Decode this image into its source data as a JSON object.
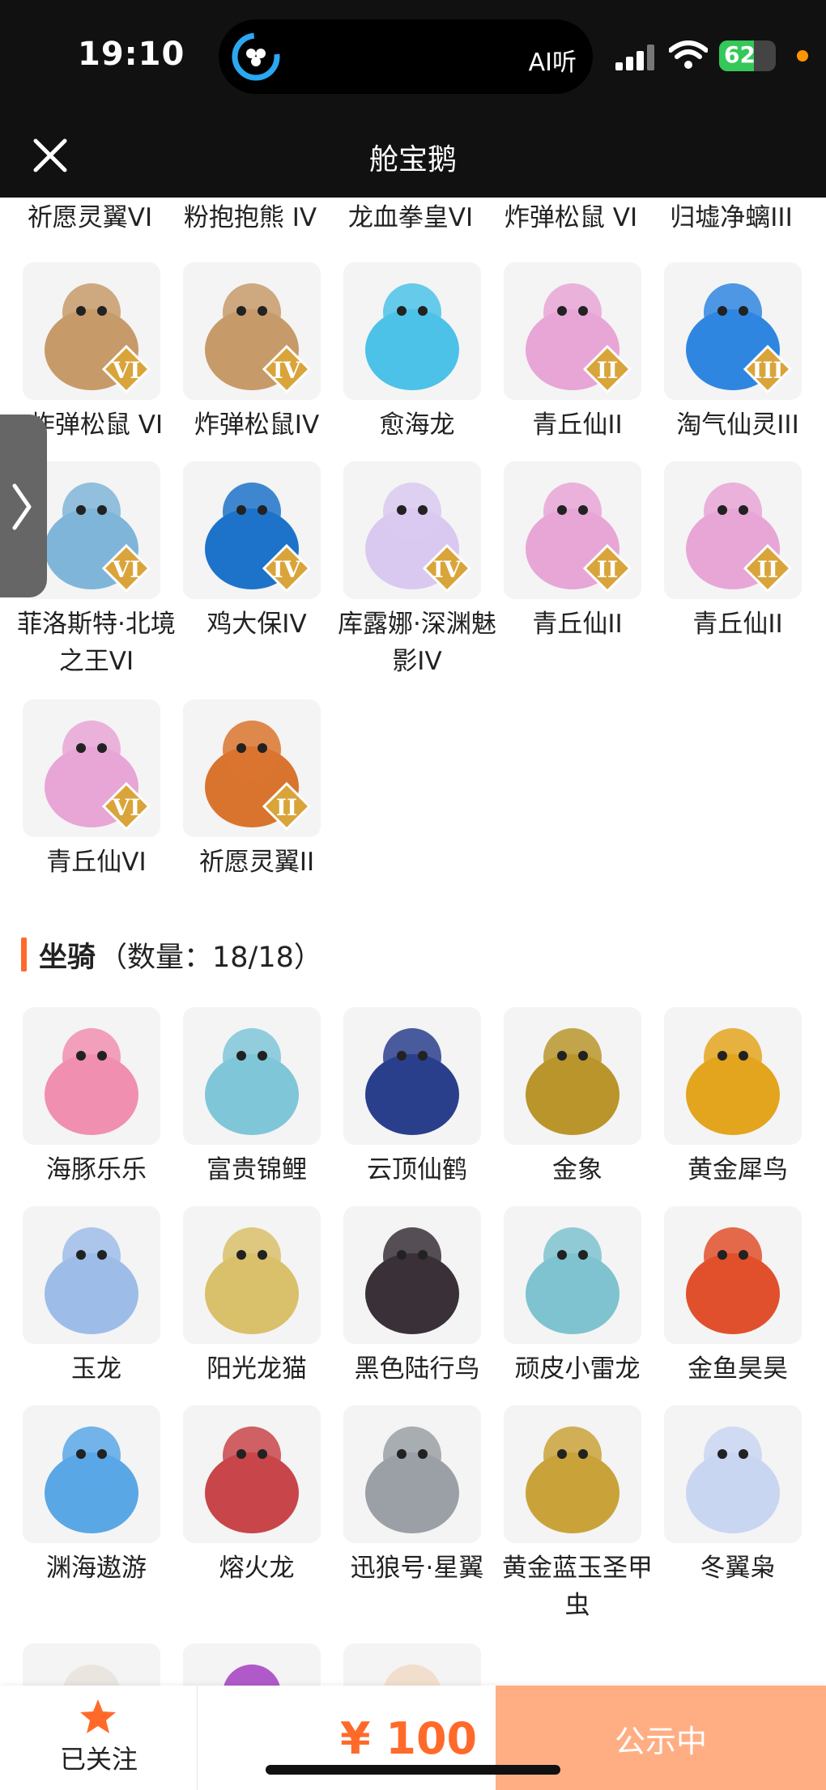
{
  "status_bar": {
    "time": "19:10",
    "island_text": "AI听",
    "battery": "62",
    "battery_fraction": 0.62
  },
  "nav": {
    "title": "舱宝鹅"
  },
  "top_partial_labels": [
    "祈愿灵翼VI",
    "粉抱抱熊 IV",
    "龙血拳皇VI",
    "炸弹松鼠 VI",
    "归墟净螭III"
  ],
  "pets": [
    {
      "label": "炸弹松鼠 VI",
      "icon": "squirrel-icon",
      "badge": "VI",
      "color": "#c79a6a"
    },
    {
      "label": "炸弹松鼠IV",
      "icon": "squirrel-icon",
      "badge": "IV",
      "color": "#c79a6a"
    },
    {
      "label": "愈海龙",
      "icon": "sea-dragon-icon",
      "badge": "",
      "color": "#4cc2e8"
    },
    {
      "label": "青丘仙II",
      "icon": "fox-fairy-icon",
      "badge": "II",
      "color": "#e7a6d6"
    },
    {
      "label": "淘气仙灵III",
      "icon": "blue-pup-icon",
      "badge": "III",
      "color": "#2f86e0"
    },
    {
      "label": "菲洛斯特·北境之王VI",
      "icon": "ice-king-icon",
      "badge": "VI",
      "color": "#7fb5d8"
    },
    {
      "label": "鸡大保IV",
      "icon": "bird-icon",
      "badge": "IV",
      "color": "#1d73c9"
    },
    {
      "label": "库露娜·深渊魅影IV",
      "icon": "phantom-icon",
      "badge": "IV",
      "color": "#d9c9f0"
    },
    {
      "label": "青丘仙II",
      "icon": "fox-fairy-icon",
      "badge": "II",
      "color": "#e7a6d6"
    },
    {
      "label": "青丘仙II",
      "icon": "fox-fairy-icon",
      "badge": "II",
      "color": "#e7a6d6"
    },
    {
      "label": "青丘仙VI",
      "icon": "fox-fairy-icon",
      "badge": "VI",
      "color": "#e7a6d6"
    },
    {
      "label": "祈愿灵翼II",
      "icon": "eagle-icon",
      "badge": "II",
      "color": "#d9742e"
    }
  ],
  "mounts_section": {
    "title": "坐骑",
    "count": "（数量：18/18）"
  },
  "mounts": [
    {
      "label": "海豚乐乐",
      "icon": "dolphin-icon",
      "color": "#f08fb0"
    },
    {
      "label": "富贵锦鲤",
      "icon": "koi-icon",
      "color": "#7fc6d8"
    },
    {
      "label": "云顶仙鹤",
      "icon": "crane-icon",
      "color": "#2a3f8c"
    },
    {
      "label": "金象",
      "icon": "elephant-icon",
      "color": "#b9952b"
    },
    {
      "label": "黄金犀鸟",
      "icon": "hornbill-icon",
      "color": "#e3a51e"
    },
    {
      "label": "玉龙",
      "icon": "jade-dragon-icon",
      "color": "#9dbde8"
    },
    {
      "label": "阳光龙猫",
      "icon": "cat-icon",
      "color": "#d9c06a"
    },
    {
      "label": "黑色陆行鸟",
      "icon": "black-bird-icon",
      "color": "#3a3038"
    },
    {
      "label": "顽皮小雷龙",
      "icon": "brontosaurus-icon",
      "color": "#7ec3cf"
    },
    {
      "label": "金鱼昊昊",
      "icon": "goldfish-icon",
      "color": "#e0502c"
    },
    {
      "label": "渊海遨游",
      "icon": "sea-prince-icon",
      "color": "#5aa7e6"
    },
    {
      "label": "熔火龙",
      "icon": "lava-dragon-icon",
      "color": "#c8454a"
    },
    {
      "label": "迅狼号·星翼",
      "icon": "mech-wolf-icon",
      "color": "#9aa0a6"
    },
    {
      "label": "黄金蓝玉圣甲虫",
      "icon": "scarab-icon",
      "color": "#c9a23a"
    },
    {
      "label": "冬翼枭",
      "icon": "owl-icon",
      "color": "#c9d6f2"
    },
    {
      "label": "",
      "icon": "mount-partial-icon",
      "color": "#e9e2dc"
    },
    {
      "label": "",
      "icon": "mount-partial-icon",
      "color": "#a33ec2"
    },
    {
      "label": "",
      "icon": "mount-partial-icon",
      "color": "#f1d9c4"
    }
  ],
  "bottom_bar": {
    "follow_label": "已关注",
    "price": "¥ 100",
    "action_label": "公示中"
  },
  "colors": {
    "accent": "#ff6a2a",
    "action_bg": "#ffae84",
    "header_bg": "#111111"
  }
}
